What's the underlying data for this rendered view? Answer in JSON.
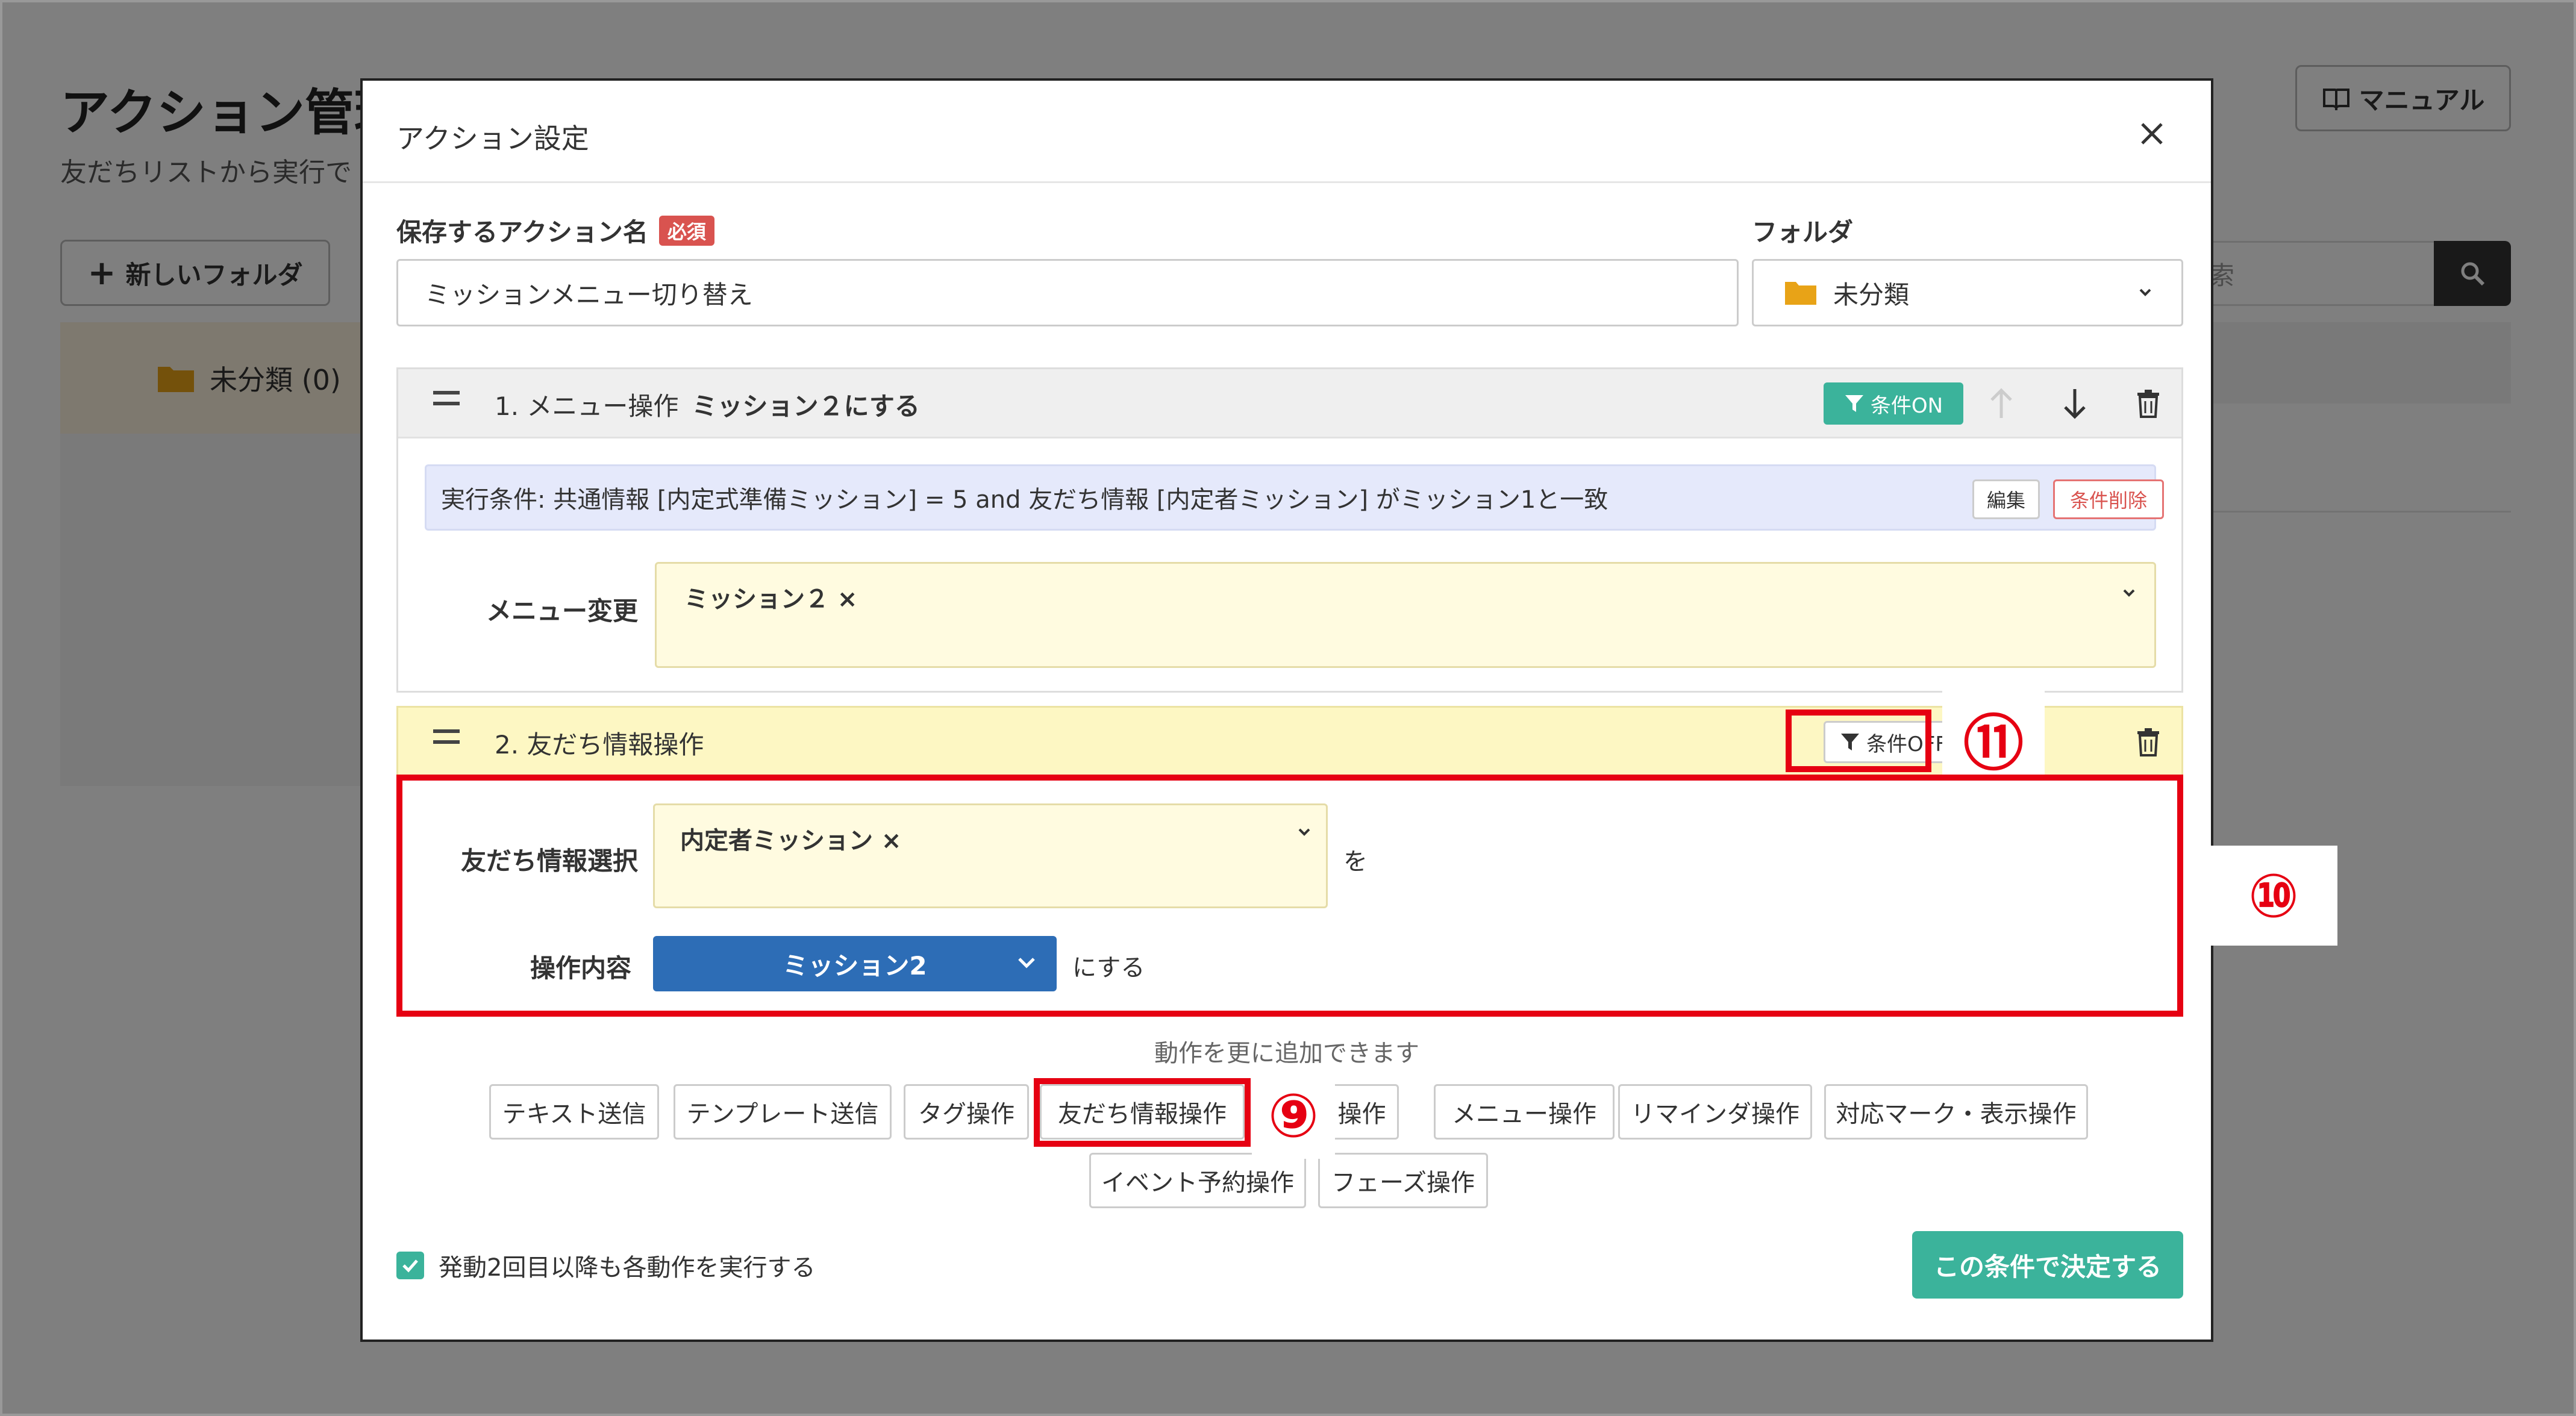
{
  "page": {
    "title": "アクション管理",
    "subtitle": "友だちリストから実行で",
    "manual_label": "マニュアル",
    "new_folder_label": "新しいフォルダ",
    "folder_item_label": "未分類 (0)",
    "search_placeholder_fragment": "索"
  },
  "modal": {
    "title": "アクション設定",
    "close_label": "×",
    "name_label": "保存するアクション名",
    "required_badge": "必須",
    "name_value": "ミッションメニュー切り替え",
    "folder_label": "フォルダ",
    "folder_value": "未分類",
    "action1": {
      "number_label": "1. メニュー操作",
      "summary": "ミッション２にする",
      "condition_toggle": "条件ON",
      "condition_text": "実行条件: 共通情報 [内定式準備ミッション] = 5 and 友だち情報 [内定者ミッション] がミッション1と一致",
      "edit_label": "編集",
      "delete_condition_label": "条件削除",
      "menu_change_label": "メニュー変更",
      "menu_tag": "ミッション２ ×"
    },
    "action2": {
      "number_label": "2. 友だち情報操作",
      "condition_toggle": "条件OFF",
      "friend_info_label": "友だち情報選択",
      "friend_info_tag": "内定者ミッション ×",
      "wo_text": "を",
      "operation_label": "操作内容",
      "operation_value": "ミッション2",
      "nisuru_text": "にする"
    },
    "add_hint": "動作を更に追加できます",
    "op_buttons": [
      "テキスト送信",
      "テンプレート送信",
      "タグ操作",
      "友だち情報操作",
      "操作",
      "メニュー操作",
      "リマインダ操作",
      "対応マーク・表示操作",
      "イベント予約操作",
      "フェーズ操作"
    ],
    "repeat_label": "発動2回目以降も各動作を実行する",
    "repeat_checked": true,
    "submit_label": "この条件で決定する"
  },
  "callouts": {
    "c9": "⑨",
    "c10": "⑩",
    "c11": "⑪"
  },
  "colors": {
    "accent_green": "#3bb39b",
    "select_blue": "#2d6db6",
    "highlight_red": "#e60012",
    "required_red": "#d9534f"
  }
}
